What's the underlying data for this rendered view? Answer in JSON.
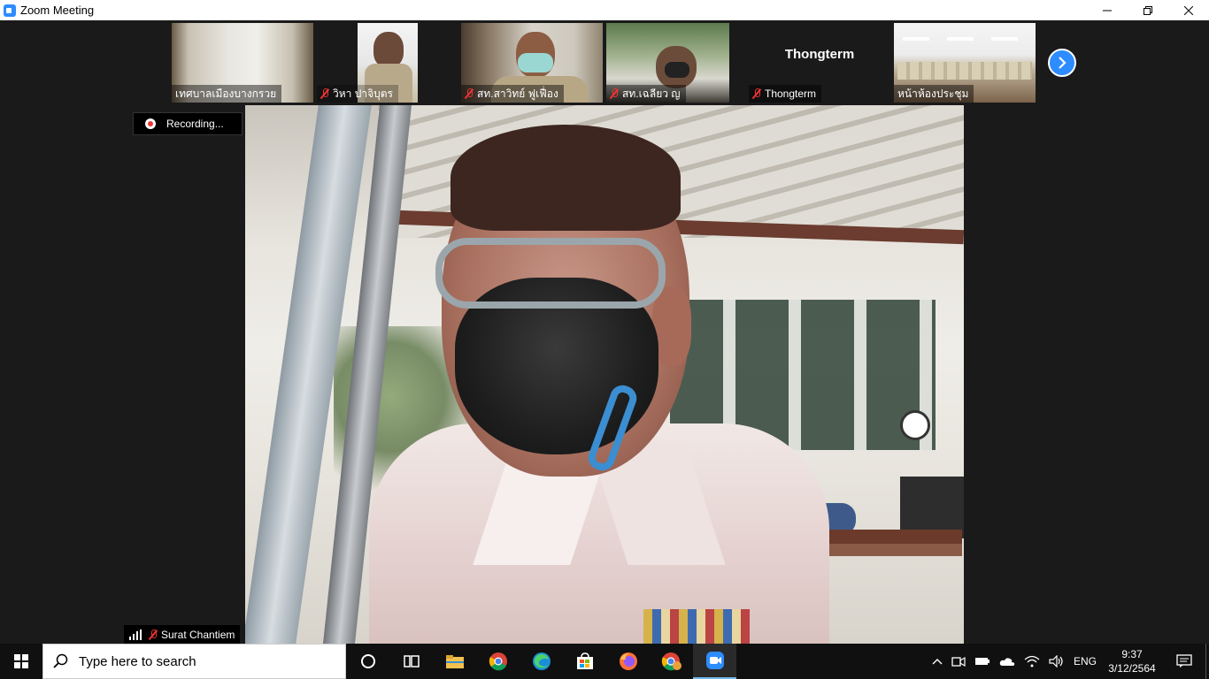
{
  "window": {
    "title": "Zoom Meeting"
  },
  "thumbnails": [
    {
      "name": "เทศบาลเมืองบางกรวย",
      "muted": false
    },
    {
      "name": "วิหา ปาจิบุตร",
      "muted": true
    },
    {
      "name": "สท.สาวิทย์  ฟูเฟื่อง",
      "muted": true
    },
    {
      "name": "สท.เฉลียว ญ",
      "muted": true
    },
    {
      "name": "Thongterm",
      "muted": true,
      "video_off_label": "Thongterm"
    },
    {
      "name": "หน้าห้องประชุม",
      "muted": false
    }
  ],
  "recording": {
    "label": "Recording..."
  },
  "active_speaker": {
    "name": "Surat Chantiem",
    "muted": true
  },
  "taskbar": {
    "search_placeholder": "Type here to search",
    "apps": [
      "cortana-icon",
      "task-view-icon",
      "file-explorer-icon",
      "chrome-icon",
      "edge-icon",
      "store-icon",
      "firefox-icon",
      "chrome-profile-icon",
      "zoom-icon"
    ],
    "language": "ENG",
    "time": "9:37",
    "date": "3/12/2564"
  },
  "colors": {
    "zoom_blue": "#2d8cff",
    "mute_red": "#e33333",
    "taskbar": "#101010"
  }
}
